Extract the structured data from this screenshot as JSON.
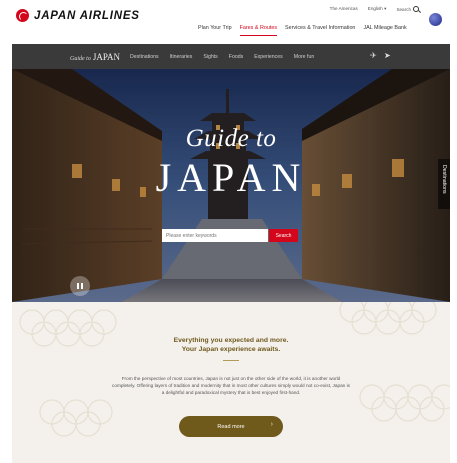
{
  "brand": {
    "logo_text": "JAPAN AIRLINES",
    "accent": "#d3061b"
  },
  "utility": {
    "region": "The Americas",
    "language": "English",
    "search": "Search"
  },
  "main_nav": [
    {
      "label": "Plan Your Trip"
    },
    {
      "label": "Fares & Routes",
      "active": true
    },
    {
      "label": "Services & Travel Information"
    },
    {
      "label": "JAL Mileage Bank"
    }
  ],
  "subnav": {
    "brand_script": "Guide to",
    "brand_main": "JAPAN",
    "links": [
      "Destinations",
      "Itineraries",
      "Sights",
      "Foods",
      "Experiences",
      "More fun"
    ]
  },
  "hero": {
    "script": "Guide to",
    "title": "JAPAN",
    "search_placeholder": "Please enter keywords",
    "search_button": "Search",
    "side_tab": "Destinations"
  },
  "content": {
    "tagline_1": "Everything you expected and more.",
    "tagline_2": "Your Japan experience awaits.",
    "body": "From the perspective of most countries, Japan is not just on the other side of the world, it is another world completely. Offering layers of tradition and modernity that in most other cultures simply would not co-exist, Japan is a delightful and paradoxical mystery that is best enjoyed first-hand.",
    "read_more": "Read more",
    "accent": "#6f5a1c"
  }
}
